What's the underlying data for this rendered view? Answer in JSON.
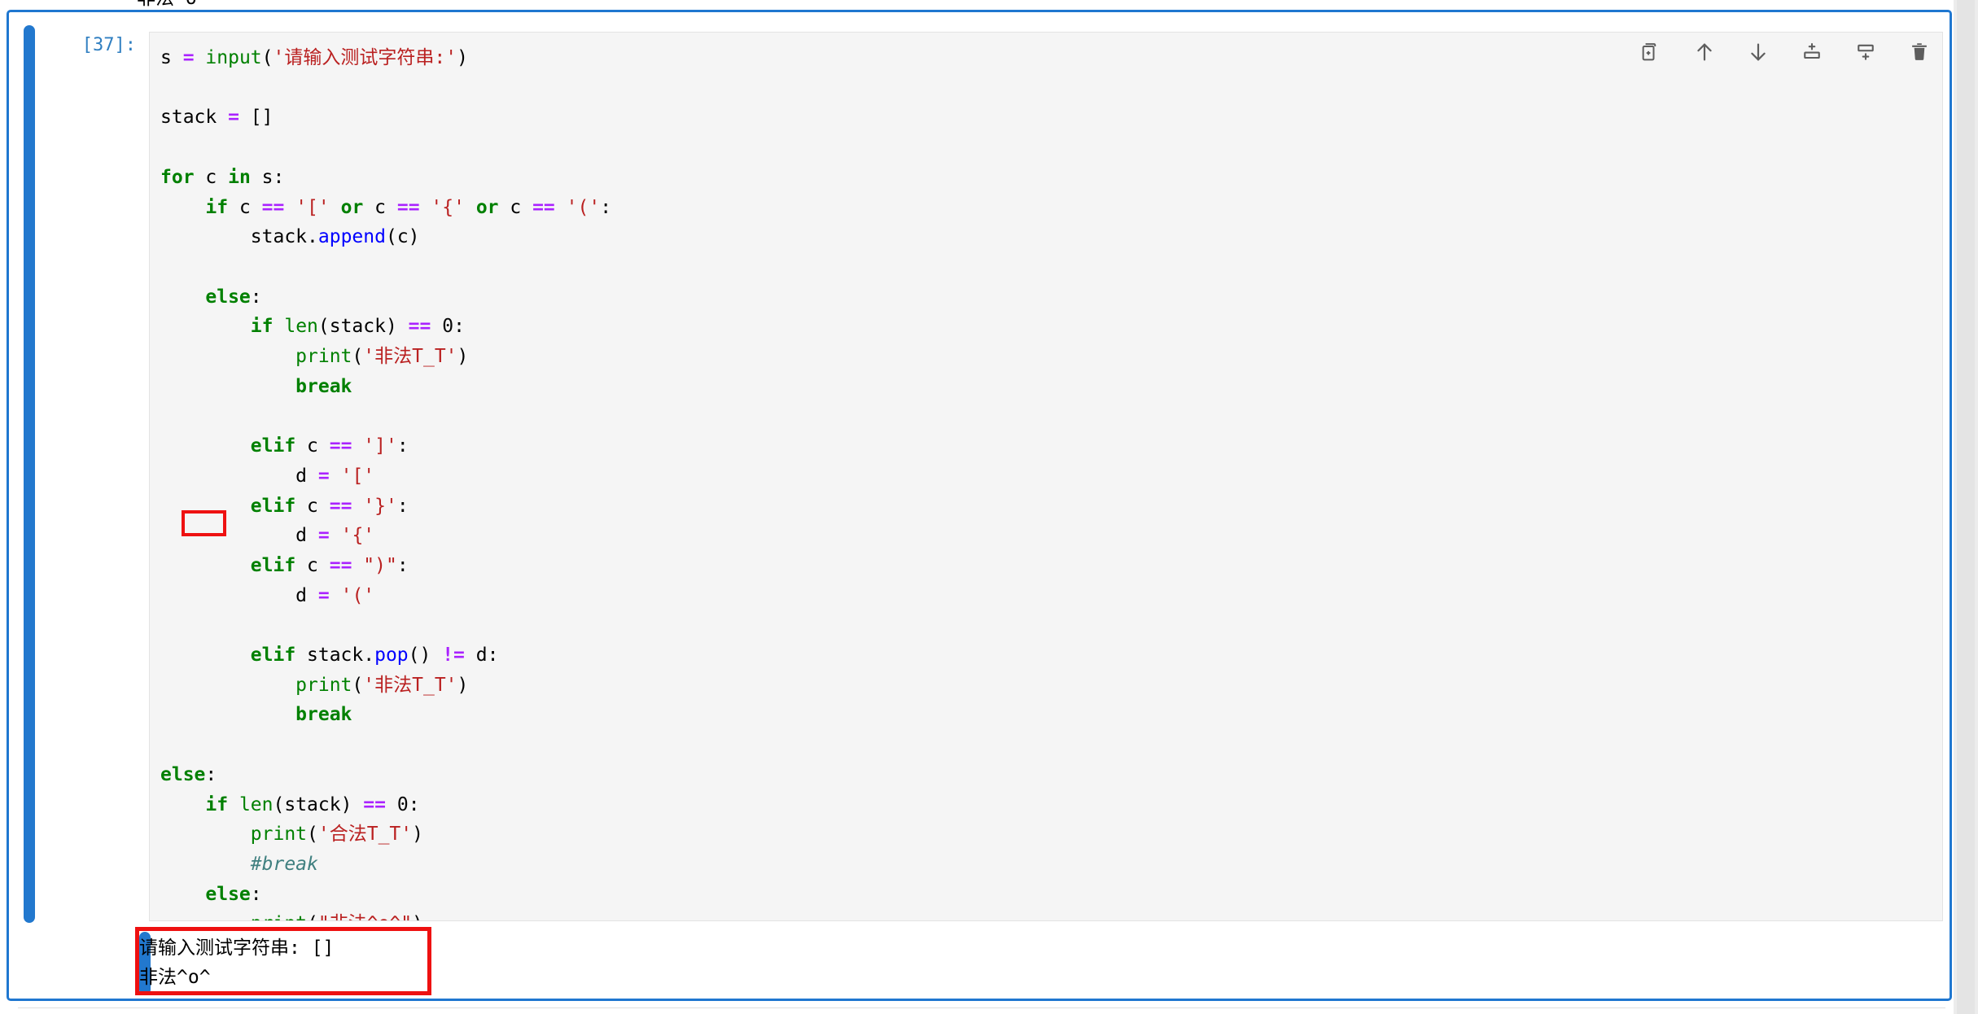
{
  "notebook": {
    "previous_output_fragment": "非法^o^",
    "cell": {
      "prompt": "[37]:",
      "execution_count": 37,
      "accent_color": "#2278ce",
      "selected": true,
      "code_lines": [
        [
          {
            "t": "s ",
            "c": "pl"
          },
          {
            "t": "=",
            "c": "op"
          },
          {
            "t": " ",
            "c": "pl"
          },
          {
            "t": "input",
            "c": "bi"
          },
          {
            "t": "(",
            "c": "pl"
          },
          {
            "t": "'请输入测试字符串:'",
            "c": "str"
          },
          {
            "t": ")",
            "c": "pl"
          }
        ],
        [],
        [
          {
            "t": "stack ",
            "c": "pl"
          },
          {
            "t": "=",
            "c": "op"
          },
          {
            "t": " []",
            "c": "pl"
          }
        ],
        [],
        [
          {
            "t": "for",
            "c": "kw"
          },
          {
            "t": " c ",
            "c": "pl"
          },
          {
            "t": "in",
            "c": "kw"
          },
          {
            "t": " s:",
            "c": "pl"
          }
        ],
        [
          {
            "t": "    ",
            "c": "pl"
          },
          {
            "t": "if",
            "c": "kw"
          },
          {
            "t": " c ",
            "c": "pl"
          },
          {
            "t": "==",
            "c": "op"
          },
          {
            "t": " ",
            "c": "pl"
          },
          {
            "t": "'['",
            "c": "str"
          },
          {
            "t": " ",
            "c": "pl"
          },
          {
            "t": "or",
            "c": "kw"
          },
          {
            "t": " c ",
            "c": "pl"
          },
          {
            "t": "==",
            "c": "op"
          },
          {
            "t": " ",
            "c": "pl"
          },
          {
            "t": "'{'",
            "c": "str"
          },
          {
            "t": " ",
            "c": "pl"
          },
          {
            "t": "or",
            "c": "kw"
          },
          {
            "t": " c ",
            "c": "pl"
          },
          {
            "t": "==",
            "c": "op"
          },
          {
            "t": " ",
            "c": "pl"
          },
          {
            "t": "'('",
            "c": "str"
          },
          {
            "t": ":",
            "c": "pl"
          }
        ],
        [
          {
            "t": "        stack.",
            "c": "pl"
          },
          {
            "t": "append",
            "c": "fn"
          },
          {
            "t": "(c)",
            "c": "pl"
          }
        ],
        [],
        [
          {
            "t": "    ",
            "c": "pl"
          },
          {
            "t": "else",
            "c": "kw"
          },
          {
            "t": ":",
            "c": "pl"
          }
        ],
        [
          {
            "t": "        ",
            "c": "pl"
          },
          {
            "t": "if",
            "c": "kw"
          },
          {
            "t": " ",
            "c": "pl"
          },
          {
            "t": "len",
            "c": "bi"
          },
          {
            "t": "(stack) ",
            "c": "pl"
          },
          {
            "t": "==",
            "c": "op"
          },
          {
            "t": " ",
            "c": "pl"
          },
          {
            "t": "0",
            "c": "num"
          },
          {
            "t": ":",
            "c": "pl"
          }
        ],
        [
          {
            "t": "            ",
            "c": "pl"
          },
          {
            "t": "print",
            "c": "bi"
          },
          {
            "t": "(",
            "c": "pl"
          },
          {
            "t": "'非法T_T'",
            "c": "str"
          },
          {
            "t": ")",
            "c": "pl"
          }
        ],
        [
          {
            "t": "            ",
            "c": "pl"
          },
          {
            "t": "break",
            "c": "kw"
          }
        ],
        [],
        [
          {
            "t": "        ",
            "c": "pl"
          },
          {
            "t": "elif",
            "c": "kw"
          },
          {
            "t": " c ",
            "c": "pl"
          },
          {
            "t": "==",
            "c": "op"
          },
          {
            "t": " ",
            "c": "pl"
          },
          {
            "t": "']'",
            "c": "str"
          },
          {
            "t": ":",
            "c": "pl"
          }
        ],
        [
          {
            "t": "            d ",
            "c": "pl"
          },
          {
            "t": "=",
            "c": "op"
          },
          {
            "t": " ",
            "c": "pl"
          },
          {
            "t": "'['",
            "c": "str"
          }
        ],
        [
          {
            "t": "        ",
            "c": "pl"
          },
          {
            "t": "elif",
            "c": "kw"
          },
          {
            "t": " c ",
            "c": "pl"
          },
          {
            "t": "==",
            "c": "op"
          },
          {
            "t": " ",
            "c": "pl"
          },
          {
            "t": "'}'",
            "c": "str"
          },
          {
            "t": ":",
            "c": "pl"
          }
        ],
        [
          {
            "t": "            d ",
            "c": "pl"
          },
          {
            "t": "=",
            "c": "op"
          },
          {
            "t": " ",
            "c": "pl"
          },
          {
            "t": "'{'",
            "c": "str"
          }
        ],
        [
          {
            "t": "        ",
            "c": "pl"
          },
          {
            "t": "elif",
            "c": "kw"
          },
          {
            "t": " c ",
            "c": "pl"
          },
          {
            "t": "==",
            "c": "op"
          },
          {
            "t": " ",
            "c": "pl"
          },
          {
            "t": "\")\"",
            "c": "str"
          },
          {
            "t": ":",
            "c": "pl"
          }
        ],
        [
          {
            "t": "            d ",
            "c": "pl"
          },
          {
            "t": "=",
            "c": "op"
          },
          {
            "t": " ",
            "c": "pl"
          },
          {
            "t": "'('",
            "c": "str"
          }
        ],
        [],
        [
          {
            "t": "        ",
            "c": "pl"
          },
          {
            "t": "elif",
            "c": "kw"
          },
          {
            "t": " stack.",
            "c": "pl"
          },
          {
            "t": "pop",
            "c": "fn"
          },
          {
            "t": "() ",
            "c": "pl"
          },
          {
            "t": "!=",
            "c": "op"
          },
          {
            "t": " d:",
            "c": "pl"
          }
        ],
        [
          {
            "t": "            ",
            "c": "pl"
          },
          {
            "t": "print",
            "c": "bi"
          },
          {
            "t": "(",
            "c": "pl"
          },
          {
            "t": "'非法T_T'",
            "c": "str"
          },
          {
            "t": ")",
            "c": "pl"
          }
        ],
        [
          {
            "t": "            ",
            "c": "pl"
          },
          {
            "t": "break",
            "c": "kw"
          }
        ],
        [],
        [
          {
            "t": "else",
            "c": "kw"
          },
          {
            "t": ":",
            "c": "pl"
          }
        ],
        [
          {
            "t": "    ",
            "c": "pl"
          },
          {
            "t": "if",
            "c": "kw"
          },
          {
            "t": " ",
            "c": "pl"
          },
          {
            "t": "len",
            "c": "bi"
          },
          {
            "t": "(stack) ",
            "c": "pl"
          },
          {
            "t": "==",
            "c": "op"
          },
          {
            "t": " ",
            "c": "pl"
          },
          {
            "t": "0",
            "c": "num"
          },
          {
            "t": ":",
            "c": "pl"
          }
        ],
        [
          {
            "t": "        ",
            "c": "pl"
          },
          {
            "t": "print",
            "c": "bi"
          },
          {
            "t": "(",
            "c": "pl"
          },
          {
            "t": "'合法T_T'",
            "c": "str"
          },
          {
            "t": ")",
            "c": "pl"
          }
        ],
        [
          {
            "t": "        ",
            "c": "pl"
          },
          {
            "t": "#break",
            "c": "cm"
          }
        ],
        [
          {
            "t": "    ",
            "c": "pl"
          },
          {
            "t": "else",
            "c": "kw"
          },
          {
            "t": ":",
            "c": "pl"
          }
        ],
        [
          {
            "t": "        ",
            "c": "pl"
          },
          {
            "t": "print",
            "c": "bi"
          },
          {
            "t": "(",
            "c": "pl"
          },
          {
            "t": "\"非法^o^\"",
            "c": "str"
          },
          {
            "t": ")",
            "c": "pl"
          }
        ]
      ],
      "highlights": [
        {
          "name": "elif-keyword-highlight",
          "color": "#ee1111",
          "target": "elif stack.pop() != d:"
        },
        {
          "name": "output-highlight",
          "color": "#ee1111",
          "target": "cell output"
        }
      ],
      "output_lines": [
        "请输入测试字符串: []",
        "非法^o^"
      ]
    },
    "toolbar": [
      {
        "id": "duplicate-cell",
        "icon": "duplicate-icon",
        "label": "Duplicate this cell"
      },
      {
        "id": "move-cell-up",
        "icon": "arrow-up-icon",
        "label": "Move this cell up"
      },
      {
        "id": "move-cell-down",
        "icon": "arrow-down-icon",
        "label": "Move this cell down"
      },
      {
        "id": "insert-cell-above",
        "icon": "insert-above-icon",
        "label": "Insert a cell above"
      },
      {
        "id": "insert-cell-below",
        "icon": "insert-below-icon",
        "label": "Insert a cell below"
      },
      {
        "id": "delete-cell",
        "icon": "trash-icon",
        "label": "Delete this cell"
      }
    ]
  }
}
